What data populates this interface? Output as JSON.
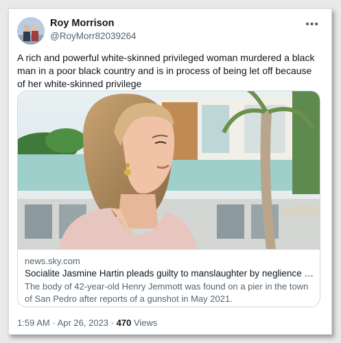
{
  "author": {
    "name": "Roy Morrison",
    "handle": "@RoyMorr82039264"
  },
  "menu_icon": "more-horizontal-icon",
  "more_glyph": "•••",
  "tweet": {
    "text": "A rich and powerful white-skinned privileged woman murdered a black man in a poor black country and is in process of being let off because of her  white-skinned privilege"
  },
  "link_card": {
    "domain": "news.sky.com",
    "headline": "Socialite Jasmine Hartin pleads guilty to manslaughter by neglience after poli...",
    "description": "The body of 42-year-old Henry Jemmott was found on a pier in the town of San Pedro after reports of a gunshot in May 2021."
  },
  "meta": {
    "time": "1:59 AM",
    "separator": "·",
    "date": "Apr 26, 2023",
    "views_count": "470",
    "views_label": "Views"
  },
  "colors": {
    "text_primary": "#0f1419",
    "text_secondary": "#536471",
    "border": "#cfd9de"
  }
}
